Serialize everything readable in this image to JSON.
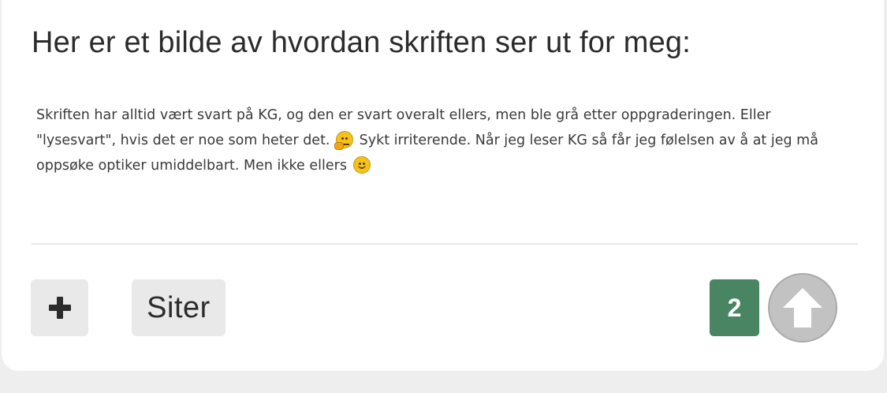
{
  "post": {
    "text": "Her er et bilde av hvordan skriften ser ut for meg:",
    "embedded_screenshot": {
      "line1": "Skriften har alltid vært svart på KG, og den er svart overalt ellers, men ble grå etter oppgraderingen. Eller",
      "line2_before_emoji": "\"lysesvart\", hvis det er noe som heter det.",
      "emoji1": "thinking-face-emoji",
      "line2_after_emoji": "Sykt irriterende. Når jeg leser KG så får jeg følelsen av å at jeg må",
      "line3": "oppsøke optiker umiddelbart. Men ikke ellers",
      "emoji2": "slightly-smiling-face-emoji"
    }
  },
  "actions": {
    "plus_icon": "plus-icon",
    "quote_label": "Siter",
    "vote_count": "2",
    "upvote_icon": "arrow-up-icon"
  },
  "colors": {
    "vote_badge": "#4a8563",
    "button_bg": "#e9e9e9",
    "upvote_circle": "#c2c2c2"
  }
}
